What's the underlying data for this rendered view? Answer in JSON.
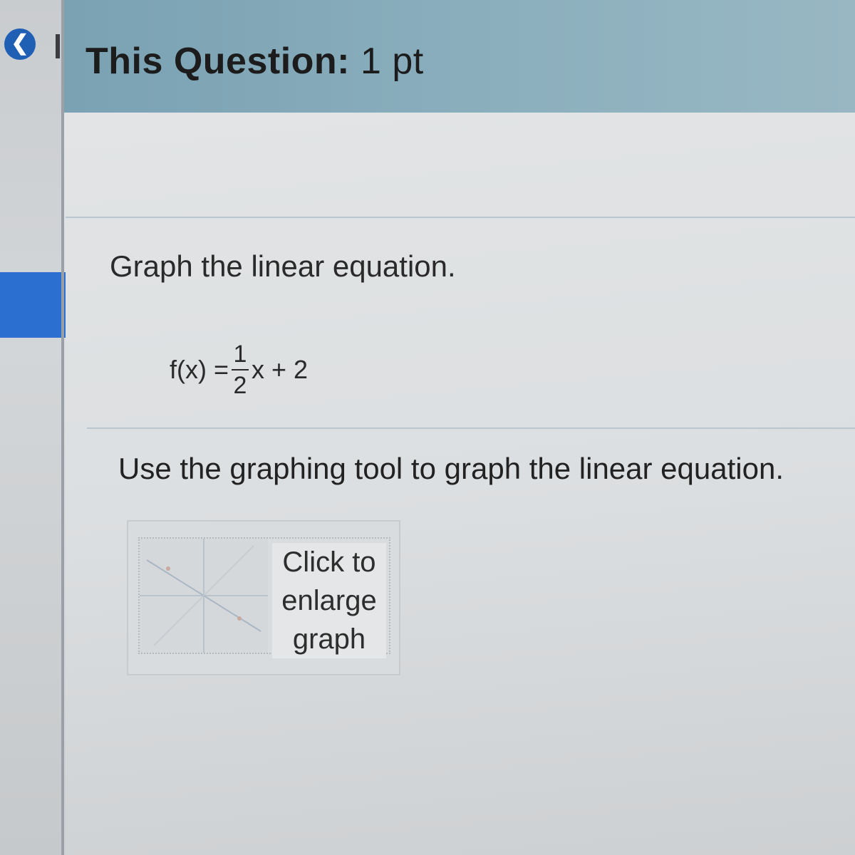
{
  "nav": {
    "back_glyph": "❮"
  },
  "header": {
    "title_prefix": "This Question:",
    "title_points": "1 pt"
  },
  "question": {
    "instruction": "Graph the linear equation.",
    "equation": {
      "lhs": "f(x) =",
      "numerator": "1",
      "denominator": "2",
      "rhs": "x + 2"
    },
    "prompt": "Use the graphing tool to graph the linear equation."
  },
  "graph_thumbnail": {
    "label_line1": "Click to",
    "label_line2": "enlarge",
    "label_line3": "graph"
  },
  "colors": {
    "header_bg": "#8db0be",
    "accent_blue": "#2b6fd0"
  }
}
